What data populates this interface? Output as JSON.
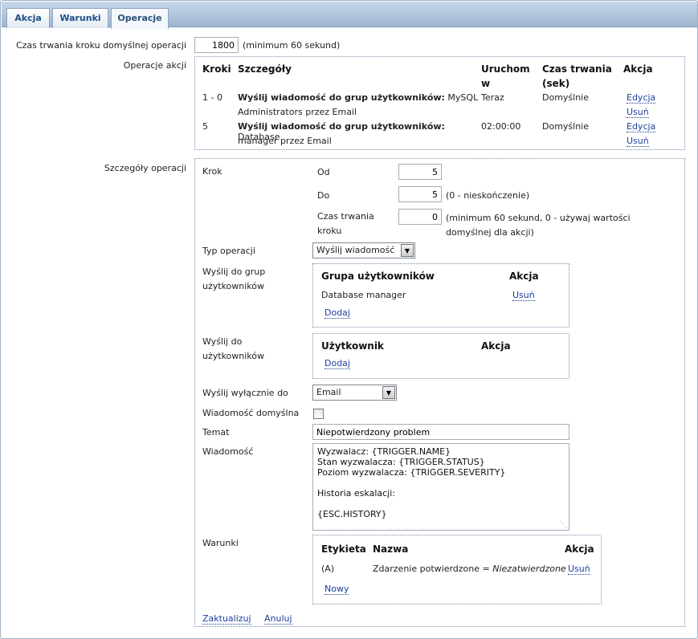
{
  "tabs": [
    {
      "label": "Akcja"
    },
    {
      "label": "Warunki"
    },
    {
      "label": "Operacje"
    }
  ],
  "default_step": {
    "label": "Czas trwania kroku domyślnej operacji",
    "value": "1800",
    "hint": "(minimum 60 sekund)"
  },
  "operations": {
    "label": "Operacje akcji",
    "headers": {
      "steps": "Kroki",
      "details": "Szczegóły",
      "start_line1": "Uruchom",
      "start_line2": "w",
      "duration_line1": "Czas trwania",
      "duration_line2": "(sek)",
      "action": "Akcja"
    },
    "rows": [
      {
        "steps": "1 - 0",
        "details_bold": "Wyślij wiadomość do grup użytkowników:",
        "details_rest1": " MySQL",
        "details_line2": "Administrators przez Email",
        "start": "Teraz",
        "duration": "Domyślnie",
        "edit": "Edycja",
        "remove": "Usuń"
      },
      {
        "steps": "5",
        "details_bold": "Wyślij wiadomość do grup użytkowników:",
        "details_rest1": " Database",
        "details_line2": "manager przez Email",
        "start": "02:00:00",
        "duration": "Domyślnie",
        "edit": "Edycja",
        "remove": "Usuń"
      }
    ]
  },
  "details": {
    "label": "Szczegóły operacji",
    "step_label": "Krok",
    "from_label": "Od",
    "from_value": "5",
    "to_label": "Do",
    "to_value": "5",
    "to_hint": "(0 - nieskończenie)",
    "duration_label1": "Czas trwania",
    "duration_label2": "kroku",
    "duration_value": "0",
    "duration_hint1": "(minimum 60 sekund, 0 - używaj wartości",
    "duration_hint2": "domyślnej dla akcji)",
    "op_type_label": "Typ operacji",
    "op_type_value": "Wyślij wiadomość",
    "send_groups_label1": "Wyślij do grup",
    "send_groups_label2": "użytkowników",
    "groups_header": "Grupa użytkowników",
    "groups_action_header": "Akcja",
    "groups": [
      {
        "name": "Database manager",
        "remove": "Usuń"
      }
    ],
    "groups_add": "Dodaj",
    "send_users_label1": "Wyślij do",
    "send_users_label2": "użytkowników",
    "users_header": "Użytkownik",
    "users_action_header": "Akcja",
    "users_add": "Dodaj",
    "send_only_label": "Wyślij wyłącznie do",
    "send_only_value": "Email",
    "default_msg_label": "Wiadomość domyślna",
    "subject_label": "Temat",
    "subject_value": "Niepotwierdzony problem",
    "message_label": "Wiadomość",
    "message_value": "Wyzwalacz: {TRIGGER.NAME}\nStan wyzwalacza: {TRIGGER.STATUS}\nPoziom wyzwalacza: {TRIGGER.SEVERITY}\n\nHistoria eskalacji:\n\n{ESC.HISTORY}",
    "conditions_label": "Warunki",
    "cond_headers": {
      "tag": "Etykieta",
      "name": "Nazwa",
      "action": "Akcja"
    },
    "conditions": [
      {
        "tag": "(A)",
        "name": "Zdarzenie potwierdzone =",
        "value": "Niezatwierdzone",
        "remove": "Usuń"
      }
    ],
    "cond_new": "Nowy",
    "update": "Zaktualizuj",
    "cancel": "Anuluj"
  }
}
